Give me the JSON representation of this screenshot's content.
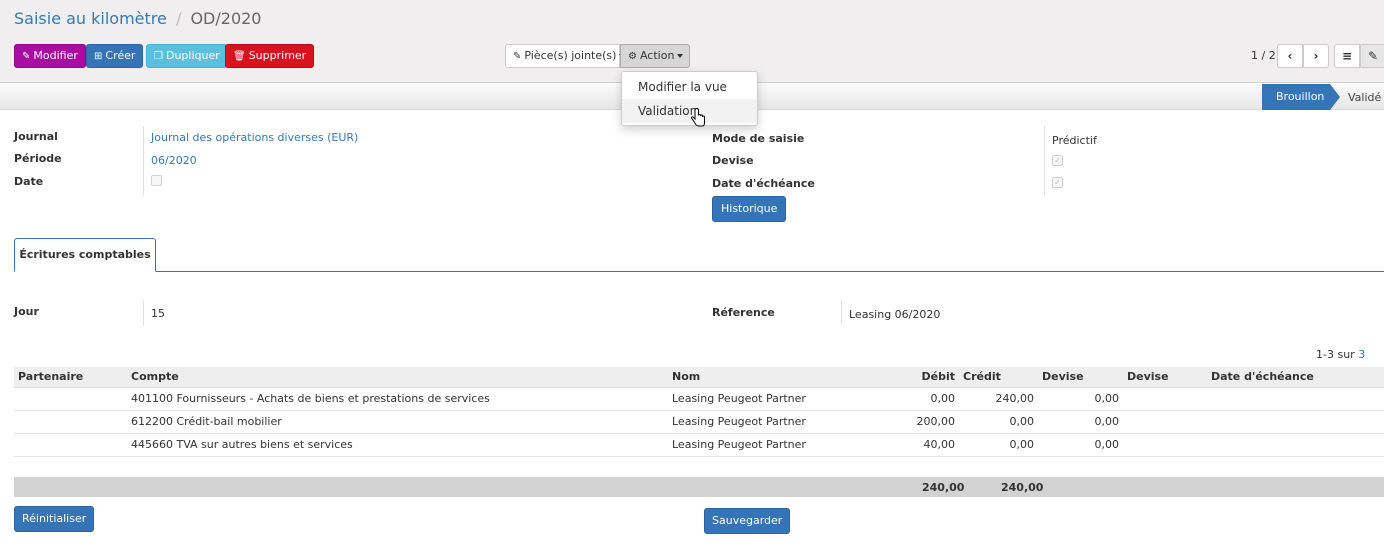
{
  "breadcrumb": {
    "parent": "Saisie au kilomètre",
    "separator": "/",
    "current": "OD/2020"
  },
  "buttons": {
    "modifier": "Modifier",
    "creer": "Créer",
    "dupliquer": "Dupliquer",
    "supprimer": "Supprimer",
    "attachments": "Pièce(s) jointe(s)",
    "action": "Action"
  },
  "action_menu": {
    "items": [
      "Modifier la vue",
      "Validation"
    ]
  },
  "pager": {
    "text": "1 / 2"
  },
  "status": {
    "active": "Brouillon",
    "next": "Validé"
  },
  "form": {
    "journal_label": "Journal",
    "journal_value": "Journal des opérations diverses (EUR)",
    "periode_label": "Période",
    "periode_value": "06/2020",
    "date_label": "Date",
    "mode_label": "Mode de saisie",
    "mode_value": "Prédictif",
    "devise_label": "Devise",
    "echeance_label": "Date d'échéance",
    "historique": "Historique"
  },
  "tab": {
    "label": "Écritures comptables"
  },
  "detail": {
    "jour_label": "Jour",
    "jour_value": "15",
    "ref_label": "Réference",
    "ref_value": "Leasing 06/2020"
  },
  "list_pager": {
    "prefix": "1-3 sur ",
    "total": "3"
  },
  "table": {
    "headers": [
      "Partenaire",
      "Compte",
      "Nom",
      "Débit",
      "Crédit",
      "Devise",
      "Devise",
      "Date d'échéance"
    ],
    "rows": [
      {
        "partenaire": "",
        "compte": "401100 Fournisseurs - Achats de biens et prestations de services",
        "nom": "Leasing Peugeot Partner",
        "debit": "0,00",
        "credit": "240,00",
        "devise": "0,00",
        "devise2": "",
        "echeance": ""
      },
      {
        "partenaire": "",
        "compte": "612200 Crédit-bail mobilier",
        "nom": "Leasing Peugeot Partner",
        "debit": "200,00",
        "credit": "0,00",
        "devise": "0,00",
        "devise2": "",
        "echeance": ""
      },
      {
        "partenaire": "",
        "compte": "445660 TVA sur autres biens et services",
        "nom": "Leasing Peugeot Partner",
        "debit": "40,00",
        "credit": "0,00",
        "devise": "0,00",
        "devise2": "",
        "echeance": ""
      }
    ],
    "total_debit": "240,00",
    "total_credit": "240,00"
  },
  "footer": {
    "reset": "Réinitialiser",
    "save": "Sauvegarder"
  },
  "icons": {
    "modifier": "edit-icon",
    "creer": "plus-square-icon",
    "dupliquer": "copy-icon",
    "supprimer": "trash-icon",
    "attachments": "paperclip-icon",
    "action": "gear-icon",
    "prev": "chevron-left-icon",
    "next": "chevron-right-icon",
    "list": "list-view-icon",
    "form": "form-view-icon"
  },
  "colors": {
    "modifier": "#a80ca0",
    "creer": "#3575b7",
    "dupliquer": "#5bc0de",
    "supprimer": "#d9121f",
    "primary": "#3575b7",
    "link": "#337ab7"
  }
}
